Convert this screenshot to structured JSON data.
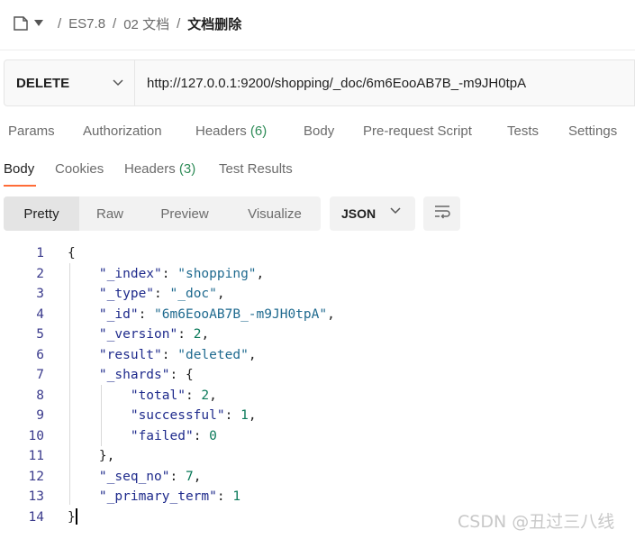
{
  "breadcrumb": {
    "parts": [
      "ES7.8",
      "02 文档"
    ],
    "current": "文档删除"
  },
  "request": {
    "method": "DELETE",
    "url": "http://127.0.0.1:9200/shopping/_doc/6m6EooAB7B_-m9JH0tpA"
  },
  "request_tabs": {
    "params": "Params",
    "authorization": "Authorization",
    "headers": "Headers",
    "headers_count": "(6)",
    "body": "Body",
    "prerequest": "Pre-request Script",
    "tests": "Tests",
    "settings": "Settings"
  },
  "response_tabs": {
    "body": "Body",
    "cookies": "Cookies",
    "headers": "Headers",
    "headers_count": "(3)",
    "test_results": "Test Results"
  },
  "view_modes": {
    "pretty": "Pretty",
    "raw": "Raw",
    "preview": "Preview",
    "visualize": "Visualize"
  },
  "format": "JSON",
  "line_numbers": [
    "1",
    "2",
    "3",
    "4",
    "5",
    "6",
    "7",
    "8",
    "9",
    "10",
    "11",
    "12",
    "13",
    "14"
  ],
  "json_body": {
    "k_index": "\"_index\"",
    "v_index": "\"shopping\"",
    "k_type": "\"_type\"",
    "v_type": "\"_doc\"",
    "k_id": "\"_id\"",
    "v_id": "\"6m6EooAB7B_-m9JH0tpA\"",
    "k_version": "\"_version\"",
    "v_version": "2",
    "k_result": "\"result\"",
    "v_result": "\"deleted\"",
    "k_shards": "\"_shards\"",
    "k_total": "\"total\"",
    "v_total": "2",
    "k_successful": "\"successful\"",
    "v_successful": "1",
    "k_failed": "\"failed\"",
    "v_failed": "0",
    "k_seq_no": "\"_seq_no\"",
    "v_seq_no": "7",
    "k_primary_term": "\"_primary_term\"",
    "v_primary_term": "1"
  },
  "watermark": "CSDN @丑过三八线",
  "colors": {
    "accent": "#ff6c37",
    "count_green": "#2e8b57"
  }
}
